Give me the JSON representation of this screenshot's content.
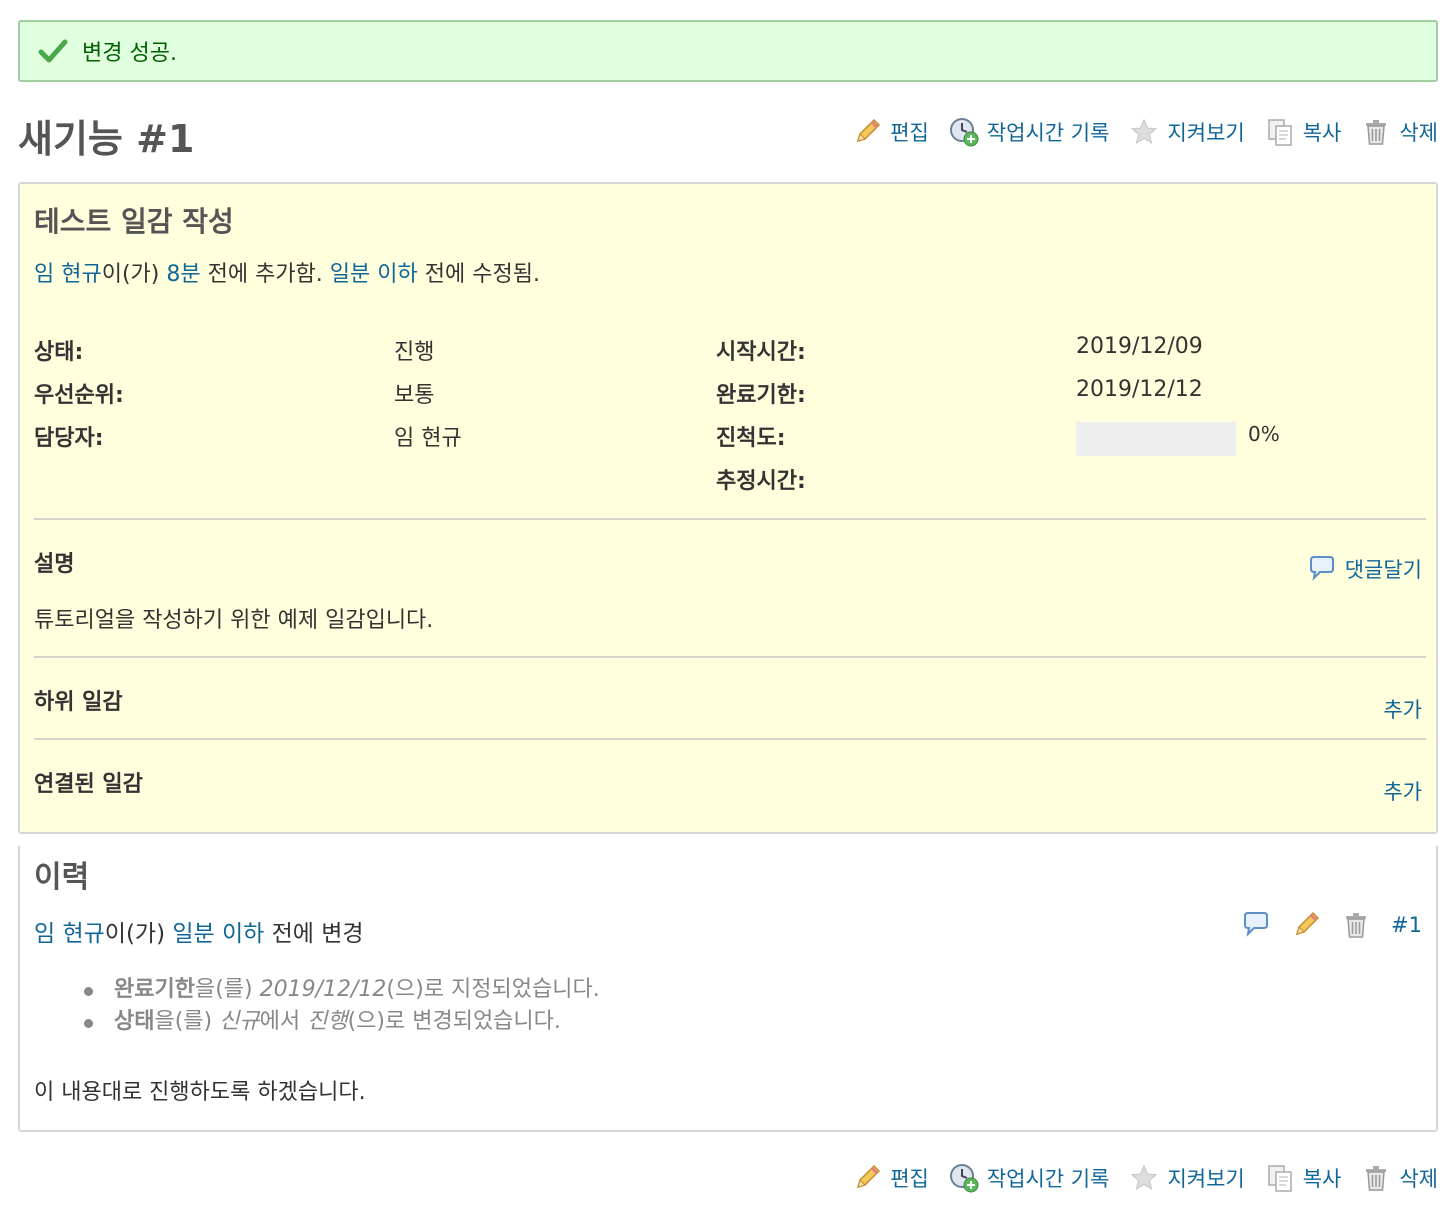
{
  "flash": {
    "message": "변경 성공."
  },
  "page_title": "새기능 #1",
  "actions": {
    "edit": "편집",
    "log_time": "작업시간 기록",
    "watch": "지켜보기",
    "copy": "복사",
    "delete": "삭제"
  },
  "issue": {
    "subject": "테스트 일감 작성",
    "author": "임 현규",
    "author_suffix": "이(가) ",
    "added_ago": "8분",
    "added_text": " 전에 추가함. ",
    "updated_ago": "일분 이하",
    "updated_text": " 전에 수정됨.",
    "attributes": {
      "status_label": "상태:",
      "status_value": "진행",
      "priority_label": "우선순위:",
      "priority_value": "보통",
      "assignee_label": "담당자:",
      "assignee_value": "임 현규",
      "start_label": "시작시간:",
      "start_value": "2019/12/09",
      "due_label": "완료기한:",
      "due_value": "2019/12/12",
      "progress_label": "진척도:",
      "progress_value": "0%",
      "progress_fraction": 0,
      "estimate_label": "추정시간:"
    },
    "description": {
      "title": "설명",
      "quote_link": "댓글달기",
      "text": "튜토리얼을 작성하기 위한 예제 일감입니다."
    },
    "subtasks": {
      "title": "하위 일감",
      "add_link": "추가"
    },
    "relations": {
      "title": "연결된 일감",
      "add_link": "추가"
    }
  },
  "history": {
    "title": "이력",
    "journal": {
      "author": "임 현규",
      "author_suffix": "이(가) ",
      "ago": "일분 이하",
      "ago_text": " 전에 변경",
      "number": "#1",
      "details": [
        {
          "field": "완료기한",
          "p1": "을(를) ",
          "value": "2019/12/12",
          "p2": "(으)로 지정되었습니다."
        },
        {
          "field": "상태",
          "p1": "을(를) ",
          "old": "신규",
          "mid": "에서 ",
          "value": "진행",
          "p2": "(으)로 변경되었습니다."
        }
      ],
      "notes": "이 내용대로 진행하도록 하겠습니다."
    }
  },
  "colors": {
    "link": "#116699",
    "flash_bg": "#dfffdf",
    "issue_bg": "#ffffdd"
  }
}
